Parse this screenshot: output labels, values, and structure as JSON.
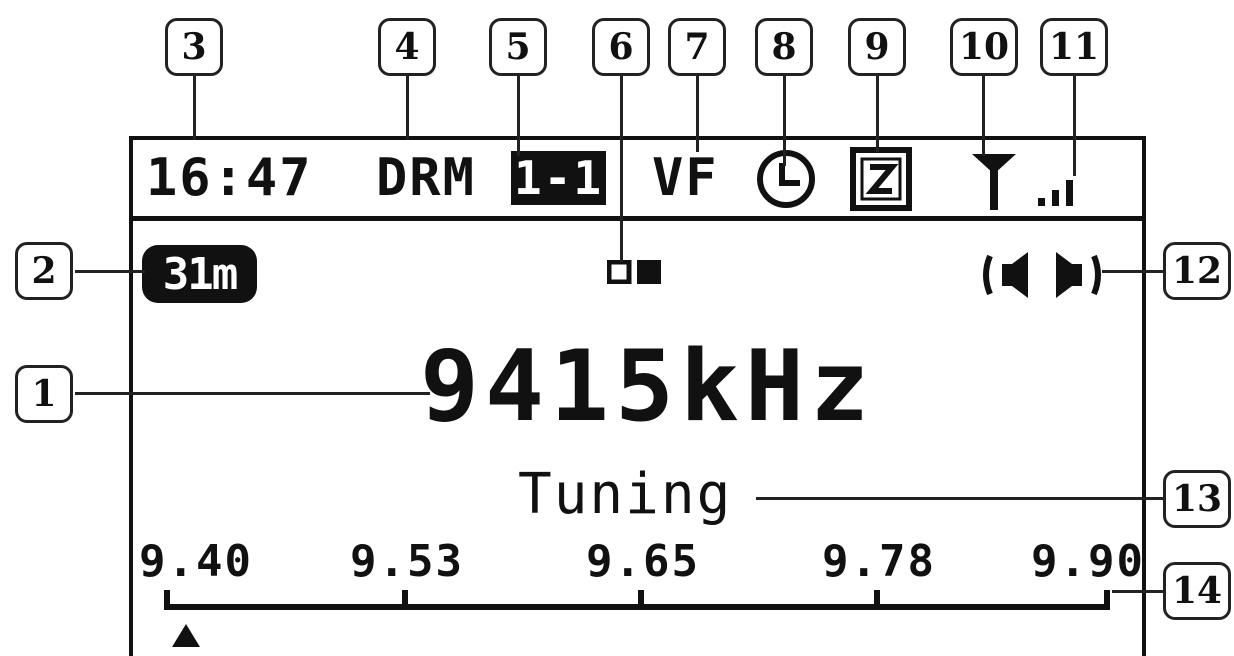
{
  "display": {
    "time": "16:47",
    "mode": "DRM",
    "program": "1-1",
    "vf": "VF",
    "band": "31m",
    "frequency": "9415kHz",
    "status": "Tuning",
    "scale": [
      "9.40",
      "9.53",
      "9.65",
      "9.78",
      "9.90"
    ]
  },
  "icons": {
    "clock": "clock-icon",
    "info": "z-box-icon",
    "antenna": "antenna-icon",
    "signal": "signal-bars-icon",
    "stereo": "speaker-stereo-icon",
    "services": "service-dots-icon",
    "pointer": "tuning-pointer-icon"
  },
  "callouts": [
    "1",
    "2",
    "3",
    "4",
    "5",
    "6",
    "7",
    "8",
    "9",
    "10",
    "11",
    "12",
    "13",
    "14"
  ]
}
